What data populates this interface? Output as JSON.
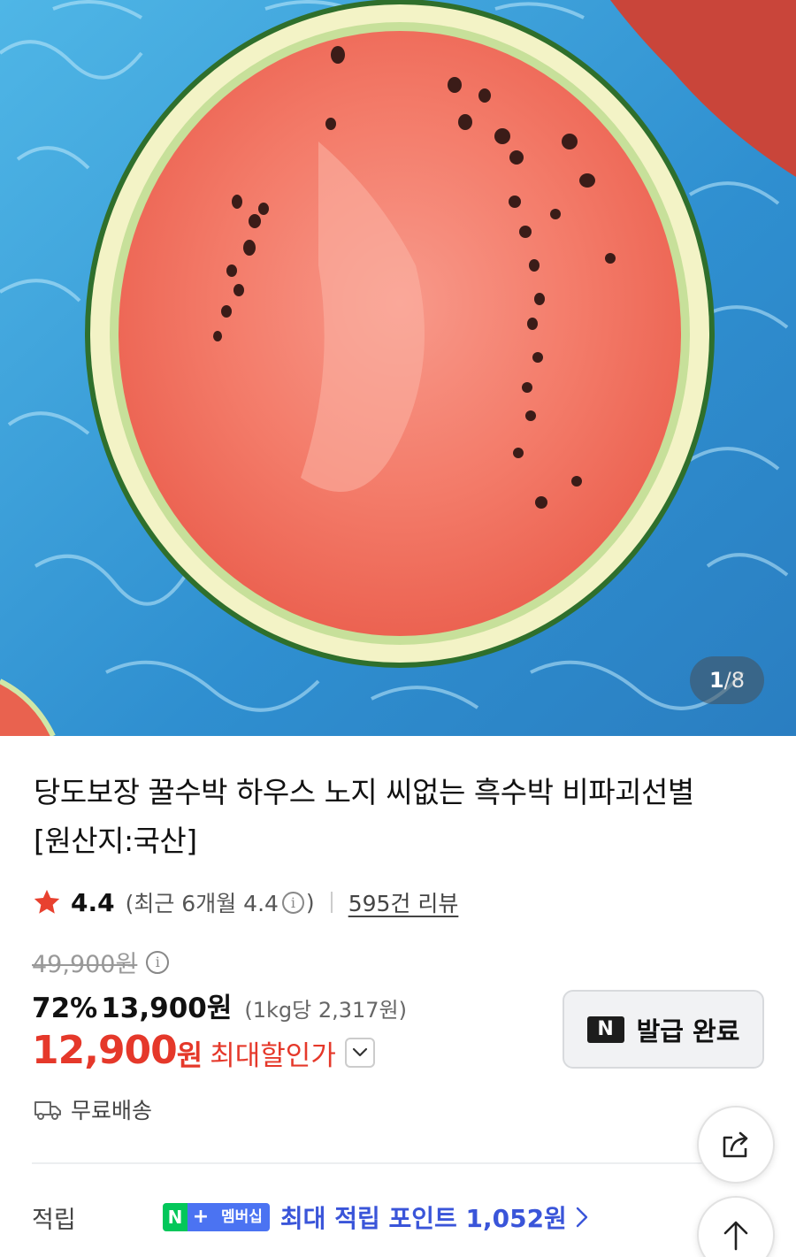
{
  "gallery": {
    "current": "1",
    "separator": "/",
    "total": "8"
  },
  "product": {
    "title_line1": "당도보장 꿀수박 하우스 노지 씨없는 흑수박 비파괴선별",
    "title_line2": "[원산지:국산]"
  },
  "rating": {
    "score": "4.4",
    "recent_prefix": "(최근 6개월 4.4",
    "recent_suffix": ")",
    "info_glyph": "i",
    "review_link": "595건 리뷰"
  },
  "price": {
    "original": "49,900원",
    "discount_rate": "72%",
    "sale": "13,900원",
    "unit": "(1kg당 2,317원)",
    "max_amount": "12,900",
    "max_currency": "원",
    "max_label": "최대할인가"
  },
  "coupon": {
    "logo": "N",
    "label": "발급 완료"
  },
  "shipping": {
    "label": "무료배송"
  },
  "points": {
    "label": "적립",
    "badge_n": "N",
    "badge_plus": "+",
    "badge_text": "멤버십",
    "text": "최대 적립 포인트 1,052원"
  },
  "colors": {
    "accent_red": "#e5382a",
    "points_blue": "#3a55d9",
    "naver_green": "#03c75a",
    "star": "#e8412f"
  },
  "icons": [
    "star-icon",
    "info-icon",
    "chevron-down-icon",
    "truck-icon",
    "chevron-right-icon",
    "share-icon",
    "arrow-up-icon"
  ]
}
